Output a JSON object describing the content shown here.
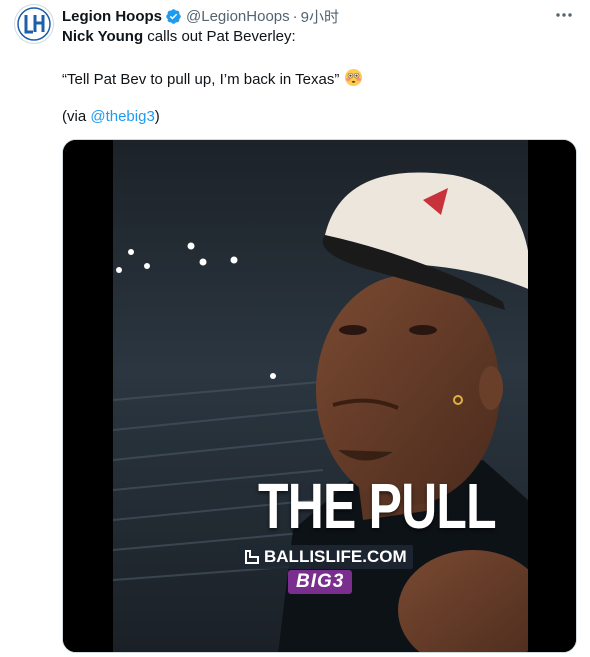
{
  "tweet": {
    "display_name": "Legion Hoops",
    "handle": "@LegionHoops",
    "separator": "·",
    "time": "9小时",
    "more_icon": "more-horizontal-icon",
    "verified_icon": "verified-badge-icon",
    "text_bold": "Nick Young",
    "text_line1_rest": " calls out Pat Beverley:",
    "quote": "“Tell Pat Bev to pull up, I’m back in Texas”",
    "emoji": "flushed-face-emoji",
    "via_prefix": "(via ",
    "via_mention": "@thebig3",
    "via_suffix": ")"
  },
  "media": {
    "overlay_title": "THE PULL",
    "overlay_brand": "BALLISLIFE.COM",
    "overlay_league": "BIG3"
  },
  "colors": {
    "link": "#1d9bf0",
    "secondary_text": "#536471",
    "verified": "#1d9bf0"
  }
}
